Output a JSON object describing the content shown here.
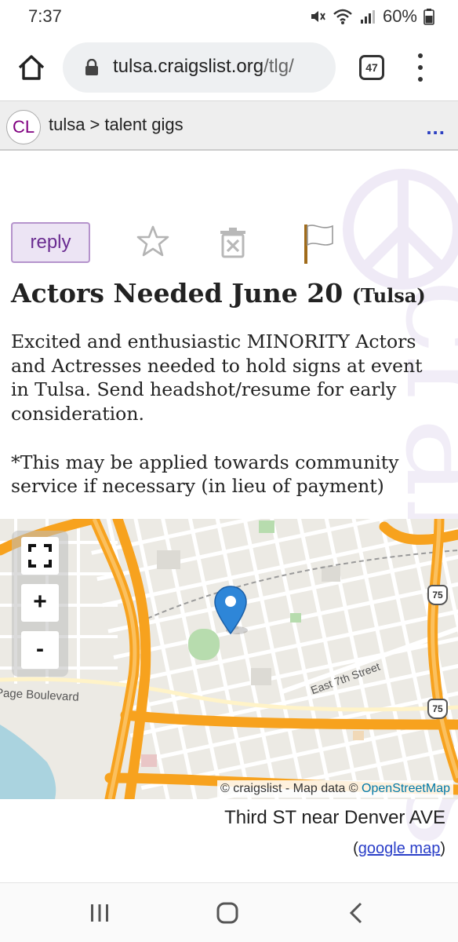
{
  "status_bar": {
    "time": "7:37",
    "battery": "60%",
    "icons": [
      "mute-icon",
      "wifi-icon",
      "signal-icon",
      "battery-icon"
    ]
  },
  "browser": {
    "url_host": "tulsa.craigslist.org",
    "url_path": "/tlg/",
    "tab_count": "47",
    "icons": [
      "home-icon",
      "lock-icon",
      "tabs-icon",
      "more-vert-icon"
    ]
  },
  "site_header": {
    "logo": "CL",
    "crumb_city": "tulsa",
    "crumb_separator": ">",
    "crumb_category": "talent gigs",
    "more": "..."
  },
  "post": {
    "reply_label": "reply",
    "title": "Actors Needed June 20",
    "location": "(Tulsa)",
    "body": [
      "Excited and enthusiastic MINORITY Actors and Actresses needed to hold signs at event in Tulsa. Send headshot/resume for early consideration.",
      "*This may be applied towards community service if necessary (in lieu of payment)"
    ],
    "action_icons": [
      "star-icon",
      "hide-trash-icon",
      "flag-icon"
    ]
  },
  "map": {
    "zoom_in": "+",
    "zoom_out": "-",
    "street_labels": [
      "Page Boulevard",
      "East 7th Street"
    ],
    "highway_shields": [
      "75",
      "75"
    ],
    "attribution_prefix": "© craigslist - Map data ©",
    "attribution_link": "OpenStreetMap",
    "address": "Third ST near Denver AVE",
    "google_open": "(",
    "google_link": "google map",
    "google_close": ")"
  },
  "colors": {
    "accent_purple": "#6a2c91",
    "link_blue": "#2a3ec8",
    "highway_orange": "#f7a21e",
    "pin_blue": "#2e86d8"
  }
}
